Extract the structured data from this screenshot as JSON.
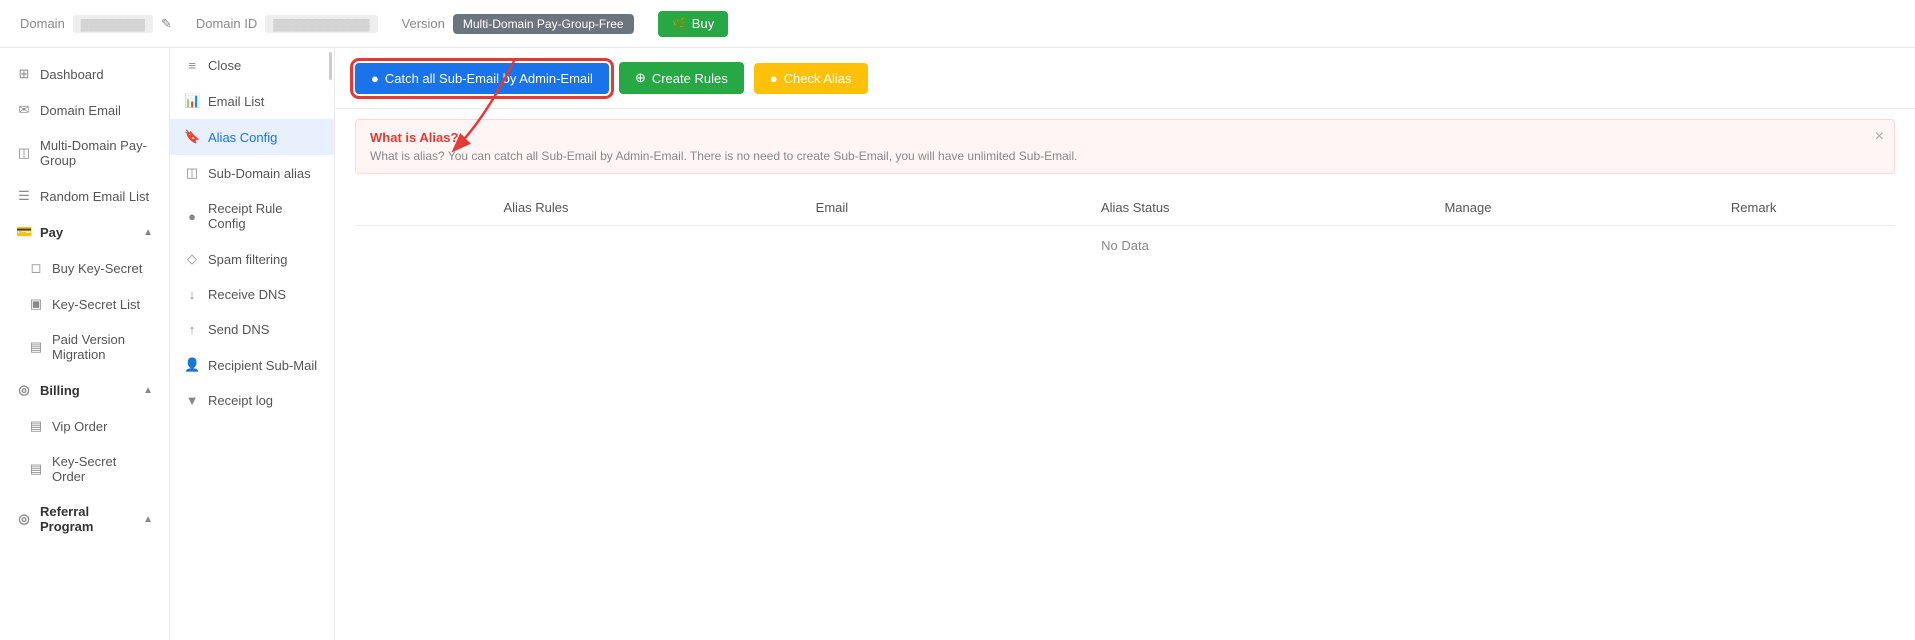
{
  "header": {
    "domain_label": "Domain",
    "domain_value": "••••••••••",
    "domain_id_label": "Domain ID",
    "domain_id_value": "••••••••••",
    "version_label": "Version",
    "version_badge": "Multi-Domain Pay-Group-Free",
    "buy_button": "Buy"
  },
  "nav": {
    "items": [
      {
        "id": "dashboard",
        "label": "Dashboard",
        "icon": "⊞"
      },
      {
        "id": "domain-email",
        "label": "Domain Email",
        "icon": "✉"
      },
      {
        "id": "multi-domain",
        "label": "Multi-Domain Pay-Group",
        "icon": "◫"
      },
      {
        "id": "random-email",
        "label": "Random Email List",
        "icon": "☰"
      },
      {
        "id": "pay",
        "label": "Pay",
        "icon": "💳",
        "has_arrow": true,
        "expanded": true
      },
      {
        "id": "buy-key-secret",
        "label": "Buy Key-Secret",
        "icon": "◻",
        "indent": true
      },
      {
        "id": "key-secret-list",
        "label": "Key-Secret List",
        "icon": "▣",
        "indent": true
      },
      {
        "id": "paid-version-migration",
        "label": "Paid Version Migration",
        "icon": "▤",
        "indent": true
      },
      {
        "id": "billing",
        "label": "Billing",
        "icon": "◎",
        "has_arrow": true,
        "expanded": true
      },
      {
        "id": "vip-order",
        "label": "Vip Order",
        "icon": "▤",
        "indent": true
      },
      {
        "id": "key-secret-order",
        "label": "Key-Secret Order",
        "icon": "▤",
        "indent": true
      },
      {
        "id": "referral-program",
        "label": "Referral Program",
        "icon": "◎",
        "has_arrow": true,
        "expanded": true
      }
    ]
  },
  "sub_nav": {
    "items": [
      {
        "id": "close",
        "label": "Close",
        "icon": "≡"
      },
      {
        "id": "email-list",
        "label": "Email List",
        "icon": "📊"
      },
      {
        "id": "alias-config",
        "label": "Alias Config",
        "icon": "🔖",
        "active": true
      },
      {
        "id": "sub-domain-alias",
        "label": "Sub-Domain alias",
        "icon": "◫"
      },
      {
        "id": "receipt-rule-config",
        "label": "Receipt Rule Config",
        "icon": "●"
      },
      {
        "id": "spam-filtering",
        "label": "Spam filtering",
        "icon": "◇"
      },
      {
        "id": "receive-dns",
        "label": "Receive DNS",
        "icon": "↓"
      },
      {
        "id": "send-dns",
        "label": "Send DNS",
        "icon": "↑"
      },
      {
        "id": "recipient-sub-mail",
        "label": "Recipient Sub-Mail",
        "icon": "👤"
      },
      {
        "id": "receipt-log",
        "label": "Receipt log",
        "icon": "▼"
      }
    ]
  },
  "action_bar": {
    "catch_button": "Catch all Sub-Email by Admin-Email",
    "create_button": "Create Rules",
    "check_button": "Check Alias"
  },
  "info_banner": {
    "title": "What is Alias?",
    "description": "What is alias? You can catch all Sub-Email by Admin-Email. There is no need to create Sub-Email, you will have unlimited Sub-Email."
  },
  "table": {
    "columns": [
      "Alias Rules",
      "Email",
      "Alias Status",
      "Manage",
      "Remark"
    ],
    "no_data": "No Data"
  },
  "icons": {
    "circle": "●",
    "plus": "+",
    "check": "✓",
    "close": "×",
    "edit": "✎"
  }
}
